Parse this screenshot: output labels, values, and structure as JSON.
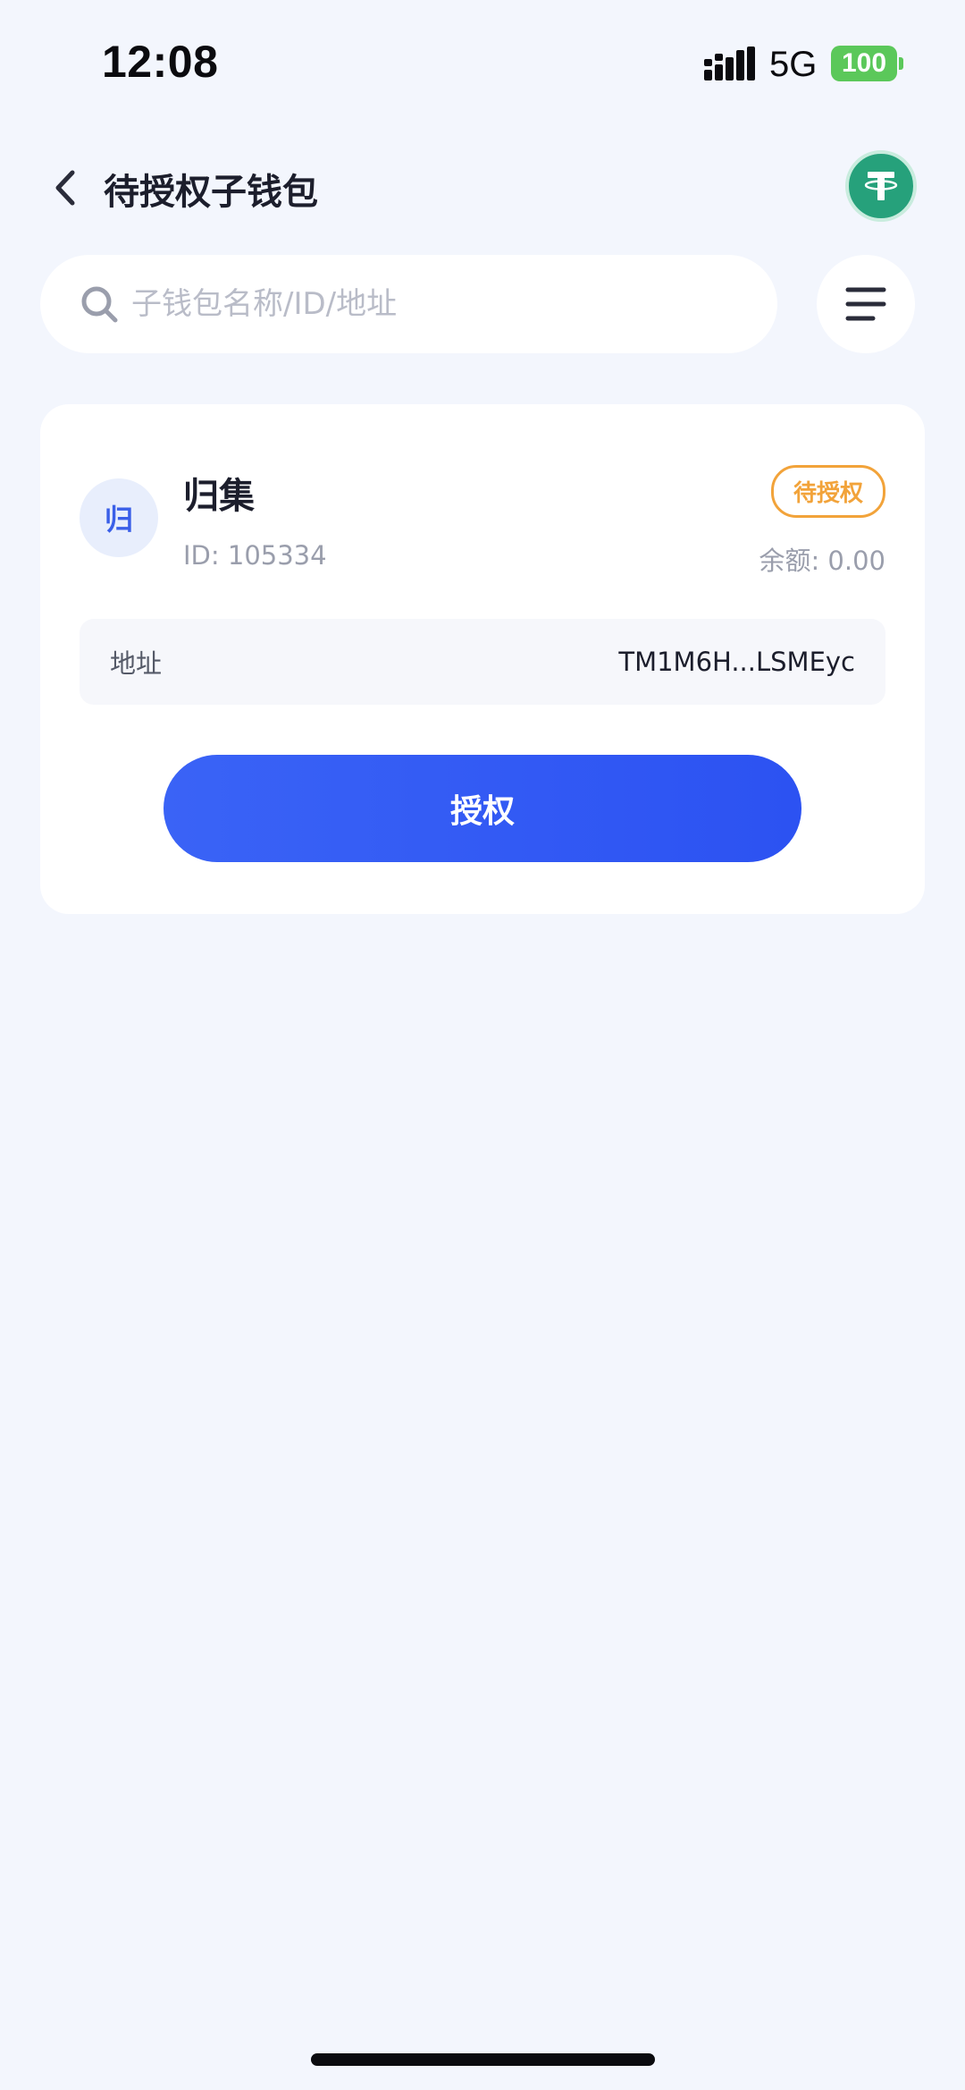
{
  "status_bar": {
    "time": "12:08",
    "network": "5G",
    "battery": "100",
    "battery_color": "#5bc85a"
  },
  "header": {
    "title": "待授权子钱包",
    "back_icon": "chevron-left-icon",
    "token_icon": "tether-icon",
    "token_color": "#26a17b"
  },
  "search": {
    "placeholder": "子钱包名称/ID/地址",
    "value": "",
    "icon": "search-icon"
  },
  "menu": {
    "icon": "menu-icon"
  },
  "wallet": {
    "avatar_text": "归",
    "name": "归集",
    "id": "ID: 105334",
    "status": "待授权",
    "status_color": "#f2a33a",
    "balance": "余额: 0.00",
    "address_label": "地址",
    "address": "TM1M6H...LSMEyc",
    "action_label": "授权",
    "action_color": "#2f57f3"
  }
}
